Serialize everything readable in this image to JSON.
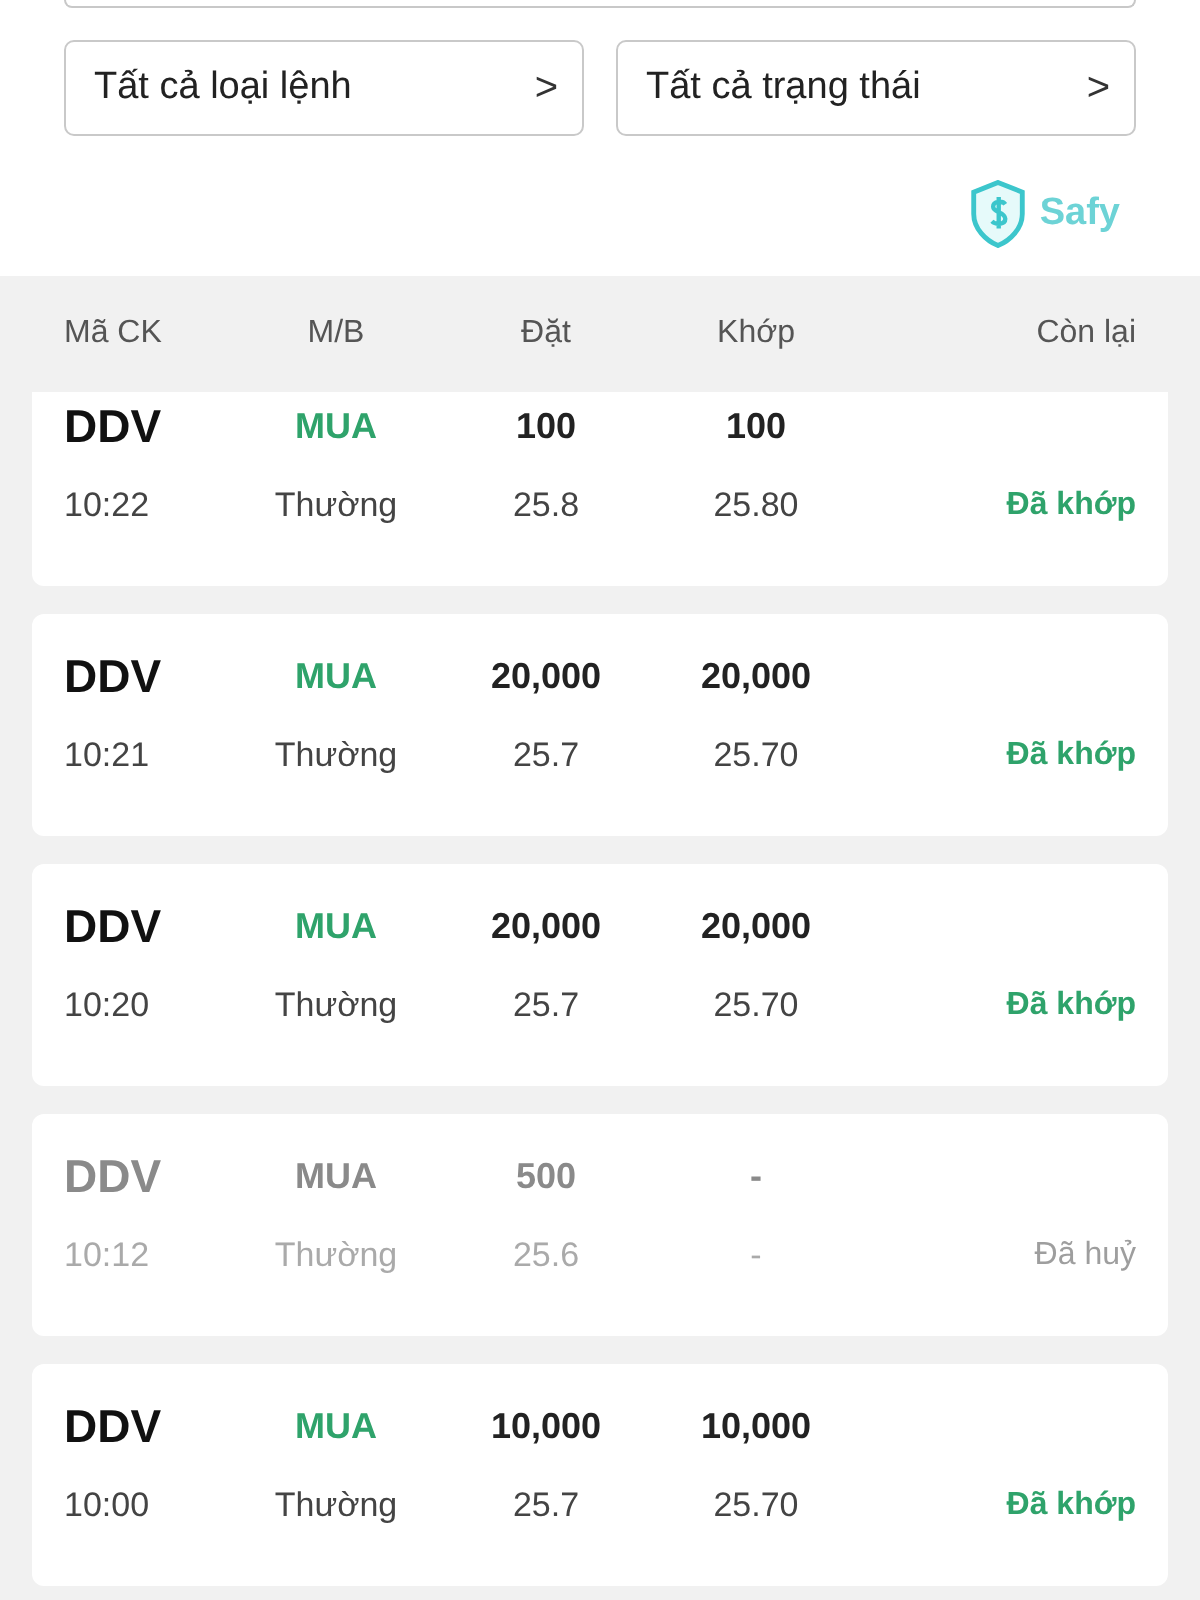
{
  "filters": [
    {
      "label": "Tất cả loại lệnh",
      "chevron": ">"
    },
    {
      "label": "Tất cả trạng thái",
      "chevron": ">"
    }
  ],
  "brand": {
    "name": "Safy"
  },
  "table": {
    "columns": [
      "Mã CK",
      "M/B",
      "Đặt",
      "Khớp",
      "Còn lại"
    ],
    "rows": [
      {
        "code": "DDV",
        "side": "MUA",
        "ordered": "100",
        "matched": "100",
        "time": "10:22",
        "type": "Thường",
        "price": "25.8",
        "matched_price": "25.80",
        "status": "Đã khớp",
        "kind": "matched"
      },
      {
        "code": "DDV",
        "side": "MUA",
        "ordered": "20,000",
        "matched": "20,000",
        "time": "10:21",
        "type": "Thường",
        "price": "25.7",
        "matched_price": "25.70",
        "status": "Đã khớp",
        "kind": "matched"
      },
      {
        "code": "DDV",
        "side": "MUA",
        "ordered": "20,000",
        "matched": "20,000",
        "time": "10:20",
        "type": "Thường",
        "price": "25.7",
        "matched_price": "25.70",
        "status": "Đã khớp",
        "kind": "matched"
      },
      {
        "code": "DDV",
        "side": "MUA",
        "ordered": "500",
        "matched": "-",
        "time": "10:12",
        "type": "Thường",
        "price": "25.6",
        "matched_price": "-",
        "status": "Đã huỷ",
        "kind": "cancelled"
      },
      {
        "code": "DDV",
        "side": "MUA",
        "ordered": "10,000",
        "matched": "10,000",
        "time": "10:00",
        "type": "Thường",
        "price": "25.7",
        "matched_price": "25.70",
        "status": "Đã khớp",
        "kind": "matched"
      }
    ]
  }
}
